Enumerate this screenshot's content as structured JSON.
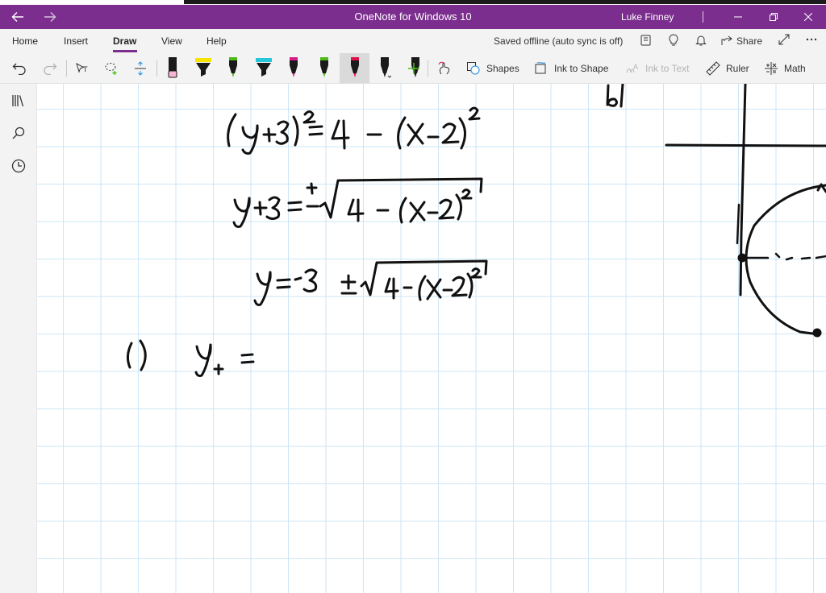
{
  "window": {
    "title": "OneNote for Windows 10",
    "user": "Luke Finney",
    "back_icon": "arrow-left-icon",
    "forward_icon": "arrow-right-icon"
  },
  "ribbon": {
    "tabs": [
      {
        "label": "Home"
      },
      {
        "label": "Insert"
      },
      {
        "label": "Draw",
        "active": true
      },
      {
        "label": "View"
      },
      {
        "label": "Help"
      }
    ],
    "sync_status": "Saved offline (auto sync is off)",
    "share_label": "Share"
  },
  "toolbar": {
    "shapes_label": "Shapes",
    "ink_to_shape_label": "Ink to Shape",
    "ink_to_text_label": "Ink to Text",
    "ruler_label": "Ruler",
    "math_label": "Math",
    "pens": [
      {
        "name": "pen-black",
        "color": "#1a1a1a"
      },
      {
        "name": "highlighter-yellow",
        "color": "#f5e400"
      },
      {
        "name": "pen-green",
        "color": "#4cbb17"
      },
      {
        "name": "highlighter-cyan",
        "color": "#26c6da"
      },
      {
        "name": "pen-magenta",
        "color": "#d81b8c"
      },
      {
        "name": "pen-green-2",
        "color": "#4cbb17"
      },
      {
        "name": "pen-red",
        "color": "#e0114b"
      },
      {
        "name": "pen-black-selected",
        "color": "#1a1a1a"
      },
      {
        "name": "pen-black-2",
        "color": "#1a1a1a"
      }
    ]
  },
  "colors": {
    "accent": "#7b2e8e",
    "grid": "#cde6f6",
    "ink": "#111111"
  }
}
